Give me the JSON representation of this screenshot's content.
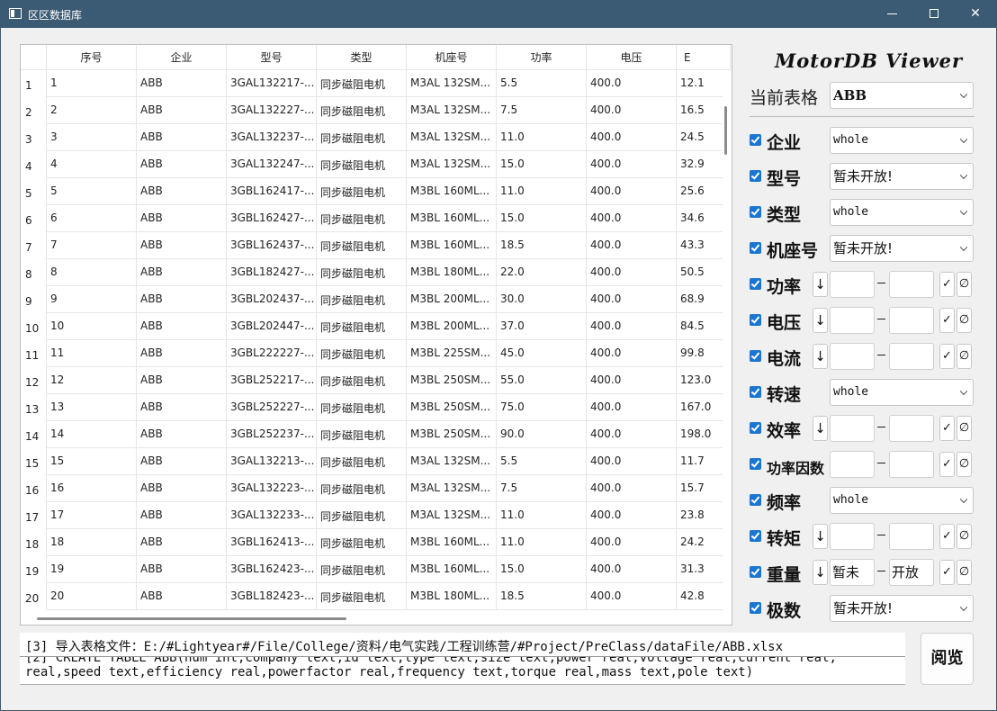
{
  "window": {
    "title": "区区数据库"
  },
  "table": {
    "columns": [
      "序号",
      "企业",
      "型号",
      "类型",
      "机座号",
      "功率",
      "电压",
      "E"
    ],
    "row_numbers": [
      "1",
      "2",
      "3",
      "4",
      "5",
      "6",
      "7",
      "8",
      "9",
      "10",
      "11",
      "12",
      "13",
      "14",
      "15",
      "16",
      "17",
      "18",
      "19",
      "20"
    ],
    "rows": [
      [
        "1",
        "ABB",
        "3GAL132217-...",
        "同步磁阻电机",
        "M3AL 132SM...",
        "5.5",
        "400.0",
        "12.1"
      ],
      [
        "2",
        "ABB",
        "3GAL132227-...",
        "同步磁阻电机",
        "M3AL 132SM...",
        "7.5",
        "400.0",
        "16.5"
      ],
      [
        "3",
        "ABB",
        "3GAL132237-...",
        "同步磁阻电机",
        "M3AL 132SM...",
        "11.0",
        "400.0",
        "24.5"
      ],
      [
        "4",
        "ABB",
        "3GAL132247-...",
        "同步磁阻电机",
        "M3AL 132SM...",
        "15.0",
        "400.0",
        "32.9"
      ],
      [
        "5",
        "ABB",
        "3GBL162417-...",
        "同步磁阻电机",
        "M3BL 160ML...",
        "11.0",
        "400.0",
        "25.6"
      ],
      [
        "6",
        "ABB",
        "3GBL162427-...",
        "同步磁阻电机",
        "M3BL 160ML...",
        "15.0",
        "400.0",
        "34.6"
      ],
      [
        "7",
        "ABB",
        "3GBL162437-...",
        "同步磁阻电机",
        "M3BL 160ML...",
        "18.5",
        "400.0",
        "43.3"
      ],
      [
        "8",
        "ABB",
        "3GBL182427-...",
        "同步磁阻电机",
        "M3BL 180ML...",
        "22.0",
        "400.0",
        "50.5"
      ],
      [
        "9",
        "ABB",
        "3GBL202437-...",
        "同步磁阻电机",
        "M3BL 200ML...",
        "30.0",
        "400.0",
        "68.9"
      ],
      [
        "10",
        "ABB",
        "3GBL202447-...",
        "同步磁阻电机",
        "M3BL 200ML...",
        "37.0",
        "400.0",
        "84.5"
      ],
      [
        "11",
        "ABB",
        "3GBL222227-...",
        "同步磁阻电机",
        "M3BL 225SM...",
        "45.0",
        "400.0",
        "99.8"
      ],
      [
        "12",
        "ABB",
        "3GBL252217-...",
        "同步磁阻电机",
        "M3BL 250SM...",
        "55.0",
        "400.0",
        "123.0"
      ],
      [
        "13",
        "ABB",
        "3GBL252227-...",
        "同步磁阻电机",
        "M3BL 250SM...",
        "75.0",
        "400.0",
        "167.0"
      ],
      [
        "14",
        "ABB",
        "3GBL252237-...",
        "同步磁阻电机",
        "M3BL 250SM...",
        "90.0",
        "400.0",
        "198.0"
      ],
      [
        "15",
        "ABB",
        "3GAL132213-...",
        "同步磁阻电机",
        "M3AL 132SM...",
        "5.5",
        "400.0",
        "11.7"
      ],
      [
        "16",
        "ABB",
        "3GAL132223-...",
        "同步磁阻电机",
        "M3AL 132SM...",
        "7.5",
        "400.0",
        "15.7"
      ],
      [
        "17",
        "ABB",
        "3GAL132233-...",
        "同步磁阻电机",
        "M3AL 132SM...",
        "11.0",
        "400.0",
        "23.8"
      ],
      [
        "18",
        "ABB",
        "3GBL162413-...",
        "同步磁阻电机",
        "M3BL 160ML...",
        "11.0",
        "400.0",
        "24.2"
      ],
      [
        "19",
        "ABB",
        "3GBL162423-...",
        "同步磁阻电机",
        "M3BL 160ML...",
        "15.0",
        "400.0",
        "31.3"
      ],
      [
        "20",
        "ABB",
        "3GBL182423-...",
        "同步磁阻电机",
        "M3BL 180ML...",
        "18.5",
        "400.0",
        "42.8"
      ]
    ]
  },
  "panel": {
    "title": "MotorDB Viewer",
    "current_table_label": "当前表格",
    "current_table_value": "ABB",
    "filters": {
      "company": {
        "label": "企业",
        "value": "whole"
      },
      "model": {
        "label": "型号",
        "value": "暂未开放!"
      },
      "type": {
        "label": "类型",
        "value": "whole"
      },
      "frame": {
        "label": "机座号",
        "value": "暂未开放!"
      },
      "power": {
        "label": "功率"
      },
      "voltage": {
        "label": "电压"
      },
      "current": {
        "label": "电流"
      },
      "speed": {
        "label": "转速",
        "value": "whole"
      },
      "efficiency": {
        "label": "效率"
      },
      "powerfactor": {
        "label": "功率因数"
      },
      "frequency": {
        "label": "频率",
        "value": "whole"
      },
      "torque": {
        "label": "转矩"
      },
      "mass": {
        "label": "重量",
        "lo": "暂未",
        "hi": "开放"
      },
      "pole": {
        "label": "极数",
        "value": "暂未开放!"
      }
    },
    "sort_glyph": "↓",
    "ok_glyph": "✓",
    "clear_glyph": "∅"
  },
  "log": {
    "line1": "[3] 导入表格文件：E:/#Lightyear#/File/College/资料/电气实践/工程训练营/#Project/PreClass/dataFile/ABB.xlsx",
    "line_partial": "[2] CREATE TABLE ABB(num int,company text,id text,type text,size text,power real,voltage real,current real,",
    "line2": "real,speed text,efficiency real,powerfactor real,frequency text,torque real,mass text,pole text)"
  },
  "browse_button": "阅览",
  "colors": {
    "titlebar": "#3b5a73",
    "checkbox": "#1976d2"
  }
}
